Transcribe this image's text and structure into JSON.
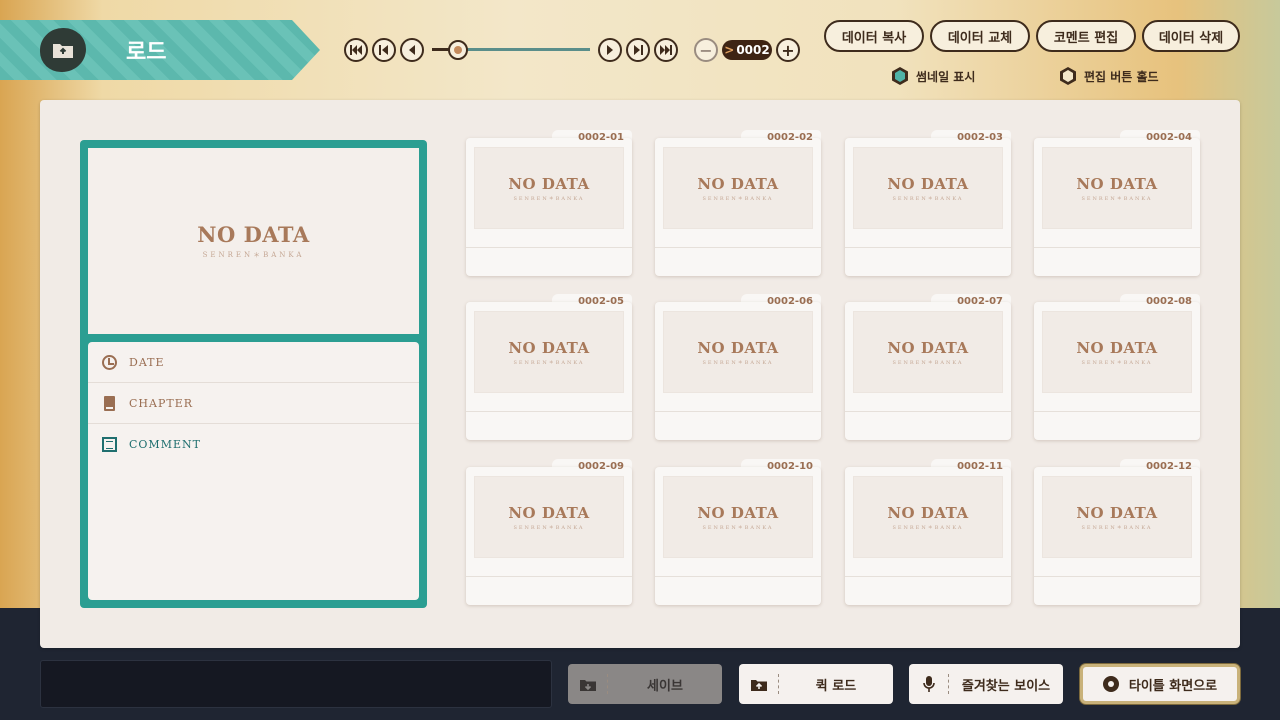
{
  "header": {
    "title": "로드",
    "pager": {
      "first_icon": "skip-first-icon",
      "prev_page_icon": "skip-prev-icon",
      "prev_icon": "prev-icon",
      "next_icon": "next-icon",
      "next_page_icon": "skip-next-icon",
      "last_icon": "skip-last-icon",
      "minus": "−",
      "plus": "+",
      "page_prefix": ">",
      "page_number": "0002",
      "slider_fraction": 0.16
    },
    "actions": {
      "copy": "데이터 복사",
      "replace": "데이터 교체",
      "edit_comment": "코멘트 편집",
      "delete": "데이터 삭제"
    },
    "toggles": {
      "thumbnail": {
        "label": "썸네일 표시",
        "on": true
      },
      "hold_edit": {
        "label": "편집 버튼 홀드",
        "on": false
      }
    }
  },
  "preview": {
    "nodata": "NO DATA",
    "brand": "SENREN＊BANKA",
    "date_label": "DATE",
    "chapter_label": "CHAPTER",
    "comment_label": "COMMENT"
  },
  "slots": [
    {
      "id": "0002-01",
      "nodata": "NO DATA",
      "brand": "SENREN＊BANKA"
    },
    {
      "id": "0002-02",
      "nodata": "NO DATA",
      "brand": "SENREN＊BANKA"
    },
    {
      "id": "0002-03",
      "nodata": "NO DATA",
      "brand": "SENREN＊BANKA"
    },
    {
      "id": "0002-04",
      "nodata": "NO DATA",
      "brand": "SENREN＊BANKA"
    },
    {
      "id": "0002-05",
      "nodata": "NO DATA",
      "brand": "SENREN＊BANKA"
    },
    {
      "id": "0002-06",
      "nodata": "NO DATA",
      "brand": "SENREN＊BANKA"
    },
    {
      "id": "0002-07",
      "nodata": "NO DATA",
      "brand": "SENREN＊BANKA"
    },
    {
      "id": "0002-08",
      "nodata": "NO DATA",
      "brand": "SENREN＊BANKA"
    },
    {
      "id": "0002-09",
      "nodata": "NO DATA",
      "brand": "SENREN＊BANKA"
    },
    {
      "id": "0002-10",
      "nodata": "NO DATA",
      "brand": "SENREN＊BANKA"
    },
    {
      "id": "0002-11",
      "nodata": "NO DATA",
      "brand": "SENREN＊BANKA"
    },
    {
      "id": "0002-12",
      "nodata": "NO DATA",
      "brand": "SENREN＊BANKA"
    }
  ],
  "footer": {
    "save": "세이브",
    "quick_load": "퀵 로드",
    "favorite_voice": "즐겨찾는 보이스",
    "to_title": "타이틀 화면으로"
  },
  "colors": {
    "accent_teal": "#2b9e92",
    "brown": "#3e2b1c",
    "nodata_text": "#a8795a"
  }
}
